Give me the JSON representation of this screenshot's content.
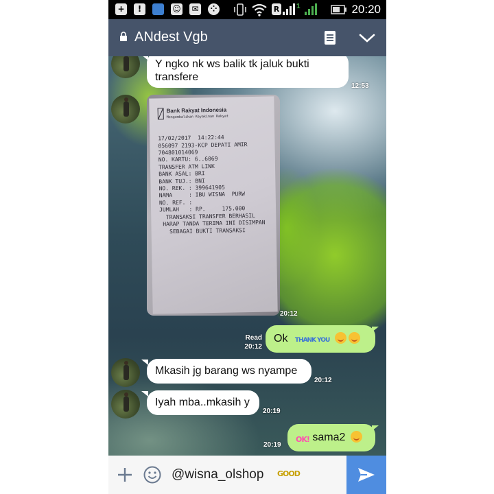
{
  "status_bar": {
    "time": "20:20",
    "indicators": [
      "plus-box-icon",
      "alert-icon",
      "cleaner-icon",
      "messenger-icon",
      "chat-bubble-icon",
      "bbm-icon",
      "vibrate-icon",
      "wifi-icon",
      "sim1-signal-icon",
      "sim2-signal-icon",
      "battery-icon"
    ],
    "sim1_label": "R",
    "sim2_label": "1"
  },
  "header": {
    "title": "ANdest Vgb",
    "icons": [
      "lock-icon",
      "notes-icon",
      "chevron-down-icon"
    ]
  },
  "messages": [
    {
      "side": "in",
      "text": "Y ngko nk ws balik tk jaluk bukti transfere",
      "time": "12:53"
    },
    {
      "side": "in",
      "type": "photo",
      "time": "20:12"
    },
    {
      "side": "out",
      "text": "Ok",
      "sticker": "THANK YOU",
      "emoji_count": 4,
      "read": "Read",
      "time": "20:12"
    },
    {
      "side": "in",
      "text": "Mkasih jg barang ws nyampe",
      "time": "20:12"
    },
    {
      "side": "in",
      "text": "Iyah mba..mkasih y",
      "time": "20:19"
    },
    {
      "side": "out",
      "text": "sama2",
      "sticker": "OK!",
      "emoji_count": 1,
      "time": "20:19"
    }
  ],
  "receipt": {
    "bank": "Bank Rakyat Indonesia",
    "subtitle": "Mengembalikan Keyakinan Rakyat",
    "lines": [
      "17/02/2017  14:22:44",
      "056097 2193-KCP DEPATI AMIR",
      "704801014069",
      "NO. KARTU: 6..6069",
      "TRANSFER ATM LINK",
      "BANK ASAL: BRI",
      "BANK TUJ.: BNI",
      "NO. REK. : 399641905",
      "NAMA     : IBU WISNA  PURW",
      "NO. REF. :",
      "JUMLAH   : RP.     175.000",
      "  TRANSAKSI TRANSFER BERHASIL",
      " HARAP TANDA TERIMA INI DISIMPAN",
      "   SEBAGAI BUKTI TRANSAKSI"
    ]
  },
  "input": {
    "value": "@wisna_olshop",
    "sticker": "GOOD"
  },
  "colors": {
    "header": "#46546a",
    "bubble_out": "#bdf08a",
    "bubble_in": "#ffffff",
    "send": "#4f8de0"
  }
}
